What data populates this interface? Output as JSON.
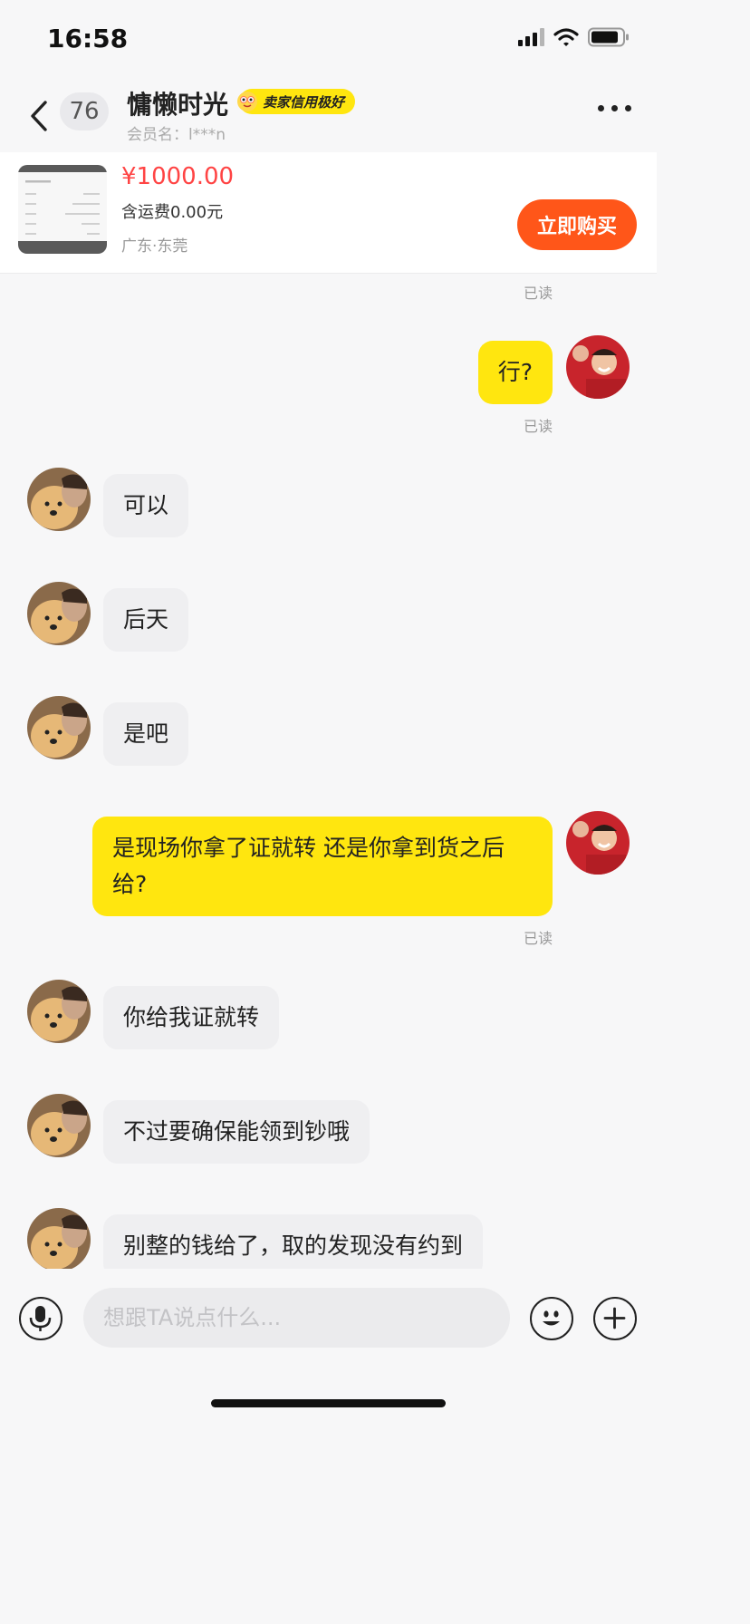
{
  "status_bar": {
    "time": "16:58"
  },
  "header": {
    "unread_count": "76",
    "name": "慵懒时光",
    "credit_badge": "卖家信用极好",
    "member_label": "会员名：",
    "member_name": "l***n"
  },
  "product": {
    "price": "¥1000.00",
    "shipping": "含运费0.00元",
    "location": "广东·东莞",
    "buy_label": "立即购买"
  },
  "chat": {
    "read_label": "已读",
    "messages": [
      {
        "from": "me",
        "text": "行?"
      },
      {
        "from": "seller",
        "text": "可以"
      },
      {
        "from": "seller",
        "text": "后天"
      },
      {
        "from": "seller",
        "text": "是吧"
      },
      {
        "from": "me",
        "text": "是现场你拿了证就转 还是你拿到货之后给?"
      },
      {
        "from": "seller",
        "text": "你给我证就转"
      },
      {
        "from": "seller",
        "text": "不过要确保能领到钞哦"
      },
      {
        "from": "seller",
        "text": "别整的钱给了，取的发现没有约到"
      }
    ]
  },
  "input": {
    "placeholder": "想跟TA说点什么..."
  },
  "colors": {
    "accent_yellow": "#ffe60f",
    "buy_orange": "#ff5619",
    "price_red": "#ff4444"
  },
  "icons": [
    "back-icon",
    "more-icon",
    "mic-icon",
    "emoji-icon",
    "plus-icon",
    "wifi-icon",
    "battery-icon",
    "signal-icon"
  ]
}
